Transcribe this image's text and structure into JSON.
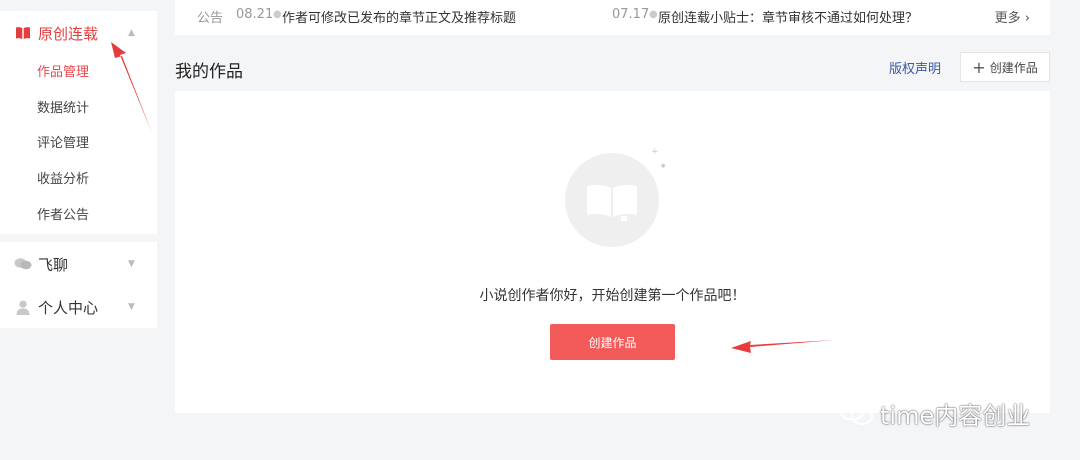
{
  "colors": {
    "accent": "#e5484d",
    "button": "#f35b5b",
    "link": "#3a5aa8",
    "arrow": "#e83b3b"
  },
  "sidebar": {
    "sections": [
      {
        "label": "原创连载",
        "icon": "book-icon",
        "expanded": true,
        "items": [
          {
            "label": "作品管理",
            "active": true
          },
          {
            "label": "数据统计"
          },
          {
            "label": "评论管理"
          },
          {
            "label": "收益分析"
          },
          {
            "label": "作者公告"
          }
        ]
      },
      {
        "label": "飞聊",
        "icon": "chat-bubbles-icon",
        "expanded": false
      },
      {
        "label": "个人中心",
        "icon": "user-icon",
        "expanded": false
      }
    ]
  },
  "notice": {
    "tag": "公告",
    "items": [
      {
        "date": "08.21",
        "text": "作者可修改已发布的章节正文及推荐标题"
      },
      {
        "date": "07.17",
        "text": "原创连载小贴士：章节审核不通过如何处理？"
      }
    ],
    "more": "更多"
  },
  "works": {
    "title": "我的作品",
    "copyright_link": "版权声明",
    "create_top": "创建作品",
    "empty_text": "小说创作者你好，开始创建第一个作品吧！",
    "create_main": "创建作品"
  },
  "watermark": {
    "text": "time内容创业"
  }
}
